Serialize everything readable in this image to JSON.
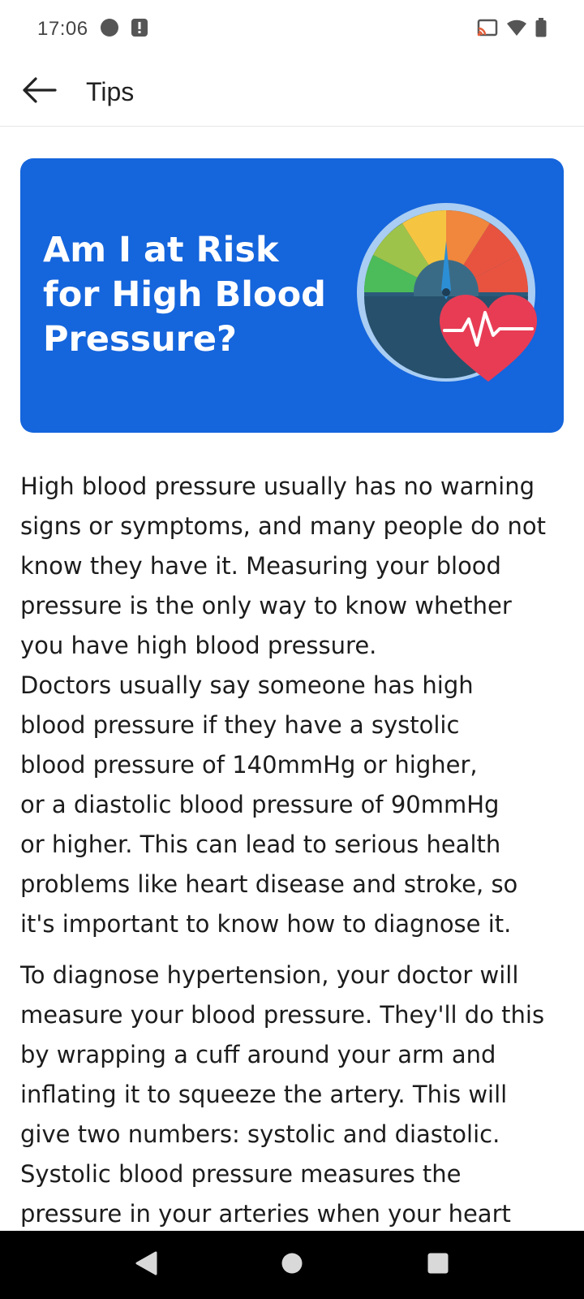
{
  "status_bar": {
    "time": "17:06",
    "icons": [
      "notification-dot-icon",
      "alert-notification-icon",
      "cast-icon",
      "wifi-icon",
      "battery-icon"
    ]
  },
  "app_bar": {
    "back_icon": "arrow-left-icon",
    "title": "Tips"
  },
  "banner": {
    "title": "Am I at Risk\nfor High Blood\nPressure?",
    "background_color": "#1565dc",
    "illustration": "blood-pressure-gauge-with-heart"
  },
  "article": {
    "paragraphs": [
      "High blood pressure usually has no warning\nsigns or symptoms, and many people do not\nknow they have it. Measuring your blood\npressure is the only way to know whether\nyou have high blood pressure.\nDoctors usually say someone has high\nblood pressure if they have a systolic\nblood pressure of 140mmHg or higher,\nor a diastolic blood pressure of 90mmHg\nor higher. This can lead to serious health\nproblems like heart disease and stroke, so\nit's important to know how to diagnose it.",
      "To diagnose hypertension, your doctor will\nmeasure your blood pressure. They'll do this\nby wrapping a cuff around your arm and\ninflating it to squeeze the artery. This will\ngive two numbers: systolic and diastolic.\nSystolic blood pressure measures the\npressure in your arteries when your heart"
    ]
  },
  "nav_bar": {
    "buttons": [
      "back-triangle-icon",
      "home-circle-icon",
      "recents-square-icon"
    ]
  }
}
